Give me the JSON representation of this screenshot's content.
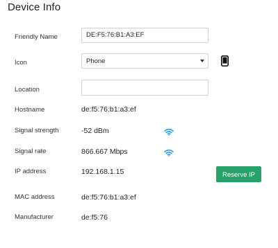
{
  "title": "Device Info",
  "fields": {
    "friendly_name": {
      "label": "Friendly Name",
      "value": "DE:F5:76:B1:A3:EF"
    },
    "icon": {
      "label": "Icon",
      "value": "Phone",
      "icon_name": "phone-icon"
    },
    "location": {
      "label": "Location",
      "value": "",
      "placeholder": ""
    },
    "hostname": {
      "label": "Hostname",
      "value": "de:f5:76:b1:a3:ef"
    },
    "signal_strength": {
      "label": "Signal strength",
      "value": "-52 dBm",
      "icon_name": "wifi-icon"
    },
    "signal_rate": {
      "label": "Signal rate",
      "value": "866.667 Mbps",
      "icon_name": "wifi-icon"
    },
    "ip_address": {
      "label": "IP address",
      "value": "192.168.1.15"
    },
    "mac_address": {
      "label": "MAC address",
      "value": "de:f5:76:b1:a3:ef"
    },
    "manufacturer": {
      "label": "Manufacturer",
      "value": "de:f5:76"
    }
  },
  "actions": {
    "reserve_ip": "Reserve IP"
  },
  "colors": {
    "accent": "#27a26a",
    "wifi": "#2d9fe6"
  }
}
